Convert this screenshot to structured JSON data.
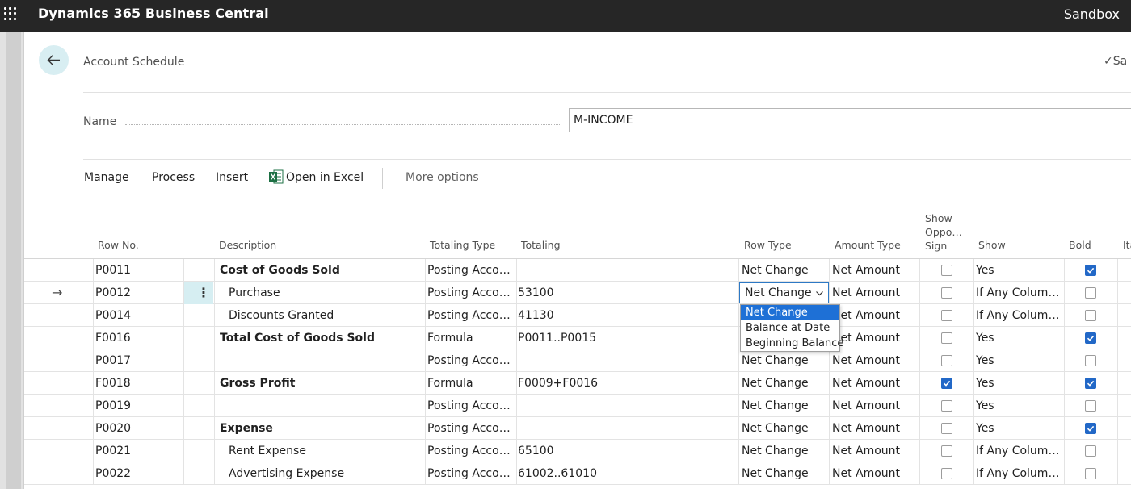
{
  "app": {
    "title": "Dynamics 365 Business Central",
    "environment": "Sandbox"
  },
  "header": {
    "page_caption": "Account Schedule",
    "save_label": "Sa"
  },
  "name_field": {
    "label": "Name",
    "value": "M-INCOME"
  },
  "actions": {
    "manage": "Manage",
    "process": "Process",
    "insert": "Insert",
    "open_in_excel": "Open in Excel",
    "more_options": "More options"
  },
  "columns": {
    "row_no": "Row No.",
    "description": "Description",
    "totaling_type": "Totaling Type",
    "totaling": "Totaling",
    "row_type": "Row Type",
    "amount_type": "Amount Type",
    "show_opposite_sign_1": "Show",
    "show_opposite_sign_2": "Oppo…",
    "show_opposite_sign_3": "Sign",
    "show": "Show",
    "bold": "Bold",
    "italic": "Ita"
  },
  "rows": [
    {
      "row_no": "P0011",
      "description": "Cost of Goods Sold",
      "bold_text": true,
      "indent": false,
      "totaling_type": "Posting Accou…",
      "totaling": "",
      "row_type": "Net Change",
      "amount_type": "Net Amount",
      "show_opposite_sign": false,
      "show": "Yes",
      "bold": true
    },
    {
      "row_no": "P0012",
      "description": "Purchase",
      "bold_text": false,
      "indent": true,
      "totaling_type": "Posting Accou…",
      "totaling": "53100",
      "row_type": "Net Change",
      "amount_type": "Net Amount",
      "show_opposite_sign": false,
      "show": "If Any Column…",
      "bold": false
    },
    {
      "row_no": "P0014",
      "description": "Discounts Granted",
      "bold_text": false,
      "indent": true,
      "totaling_type": "Posting Accou…",
      "totaling": "41130",
      "row_type": "",
      "amount_type": "Net Amount",
      "show_opposite_sign": false,
      "show": "If Any Column…",
      "bold": false
    },
    {
      "row_no": "F0016",
      "description": "Total Cost of Goods Sold",
      "bold_text": true,
      "indent": false,
      "totaling_type": "Formula",
      "totaling": "P0011..P0015",
      "row_type": "",
      "amount_type": "Net Amount",
      "show_opposite_sign": false,
      "show": "Yes",
      "bold": true
    },
    {
      "row_no": "P0017",
      "description": "",
      "bold_text": false,
      "indent": false,
      "totaling_type": "Posting Accou…",
      "totaling": "",
      "row_type": "Net Change",
      "amount_type": "Net Amount",
      "show_opposite_sign": false,
      "show": "Yes",
      "bold": false
    },
    {
      "row_no": "F0018",
      "description": "Gross Profit",
      "bold_text": true,
      "indent": false,
      "totaling_type": "Formula",
      "totaling": "F0009+F0016",
      "row_type": "Net Change",
      "amount_type": "Net Amount",
      "show_opposite_sign": true,
      "show": "Yes",
      "bold": true
    },
    {
      "row_no": "P0019",
      "description": "",
      "bold_text": false,
      "indent": false,
      "totaling_type": "Posting Accou…",
      "totaling": "",
      "row_type": "Net Change",
      "amount_type": "Net Amount",
      "show_opposite_sign": false,
      "show": "Yes",
      "bold": false
    },
    {
      "row_no": "P0020",
      "description": "Expense",
      "bold_text": true,
      "indent": false,
      "totaling_type": "Posting Accou…",
      "totaling": "",
      "row_type": "Net Change",
      "amount_type": "Net Amount",
      "show_opposite_sign": false,
      "show": "Yes",
      "bold": true
    },
    {
      "row_no": "P0021",
      "description": "Rent Expense",
      "bold_text": false,
      "indent": true,
      "totaling_type": "Posting Accou…",
      "totaling": "65100",
      "row_type": "Net Change",
      "amount_type": "Net Amount",
      "show_opposite_sign": false,
      "show": "If Any Column…",
      "bold": false
    },
    {
      "row_no": "P0022",
      "description": "Advertising Expense",
      "bold_text": false,
      "indent": true,
      "totaling_type": "Posting Accou…",
      "totaling": "61002..61010",
      "row_type": "Net Change",
      "amount_type": "Net Amount",
      "show_opposite_sign": false,
      "show": "If Any Column…",
      "bold": false
    }
  ],
  "active_row_select": {
    "value": "Net Change"
  },
  "row_type_dropdown": {
    "options": [
      "Net Change",
      "Balance at Date",
      "Beginning Balance"
    ],
    "selected": "Net Change"
  },
  "icons": {
    "back": "back-arrow-icon",
    "excel": "excel-icon",
    "app_launcher": "waffle-icon",
    "row_indicator": "right-arrow-icon"
  },
  "colors": {
    "topbar": "#262626",
    "accent": "#2268c7",
    "selection": "#1e70d6",
    "back_button": "#d8eef2",
    "excel_green": "#1d7044"
  }
}
